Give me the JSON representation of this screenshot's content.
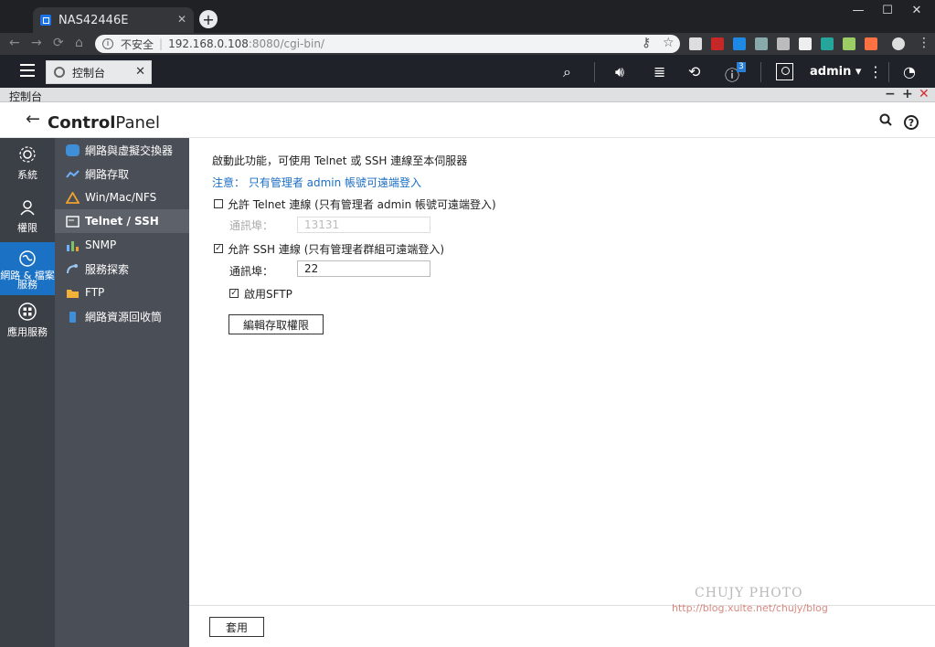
{
  "browser": {
    "tab_title": "NAS42446E",
    "security_label": "不安全",
    "url_host": "192.168.0.108",
    "url_rest": ":8080/cgi-bin/"
  },
  "topbar": {
    "app_tab_label": "控制台",
    "notification_count": "3",
    "username": "admin"
  },
  "window": {
    "title": "控制台"
  },
  "header": {
    "brand_bold": "Control",
    "brand_rest": "Panel",
    "help": "?"
  },
  "rail": [
    {
      "label": "系統"
    },
    {
      "label": "權限"
    },
    {
      "label": "網路 & 檔案服務",
      "active": true
    },
    {
      "label": "應用服務"
    }
  ],
  "submenu": [
    {
      "label": "網路與虛擬交換器"
    },
    {
      "label": "網路存取"
    },
    {
      "label": "Win/Mac/NFS"
    },
    {
      "label": "Telnet / SSH",
      "active": true
    },
    {
      "label": "SNMP"
    },
    {
      "label": "服務探索"
    },
    {
      "label": "FTP"
    },
    {
      "label": "網路資源回收筒"
    }
  ],
  "content": {
    "intro": "啟動此功能，可使用 Telnet 或 SSH 連線至本伺服器",
    "note": "注意： 只有管理者 admin 帳號可遠端登入",
    "telnet_label": "允許 Telnet 連線 (只有管理者 admin 帳號可遠端登入)",
    "telnet_checked": false,
    "telnet_port_label": "通訊埠：",
    "telnet_port": "13131",
    "ssh_label": "允許 SSH 連線 (只有管理者群組可遠端登入)",
    "ssh_checked": true,
    "ssh_port_label": "通訊埠：",
    "ssh_port": "22",
    "sftp_label": "啟用SFTP",
    "sftp_checked": true,
    "edit_button": "編輯存取權限"
  },
  "footer": {
    "apply_button": "套用"
  },
  "watermark": {
    "line1": "CHUJY PHOTO",
    "line2": "http://blog.xuite.net/chujy/blog"
  }
}
